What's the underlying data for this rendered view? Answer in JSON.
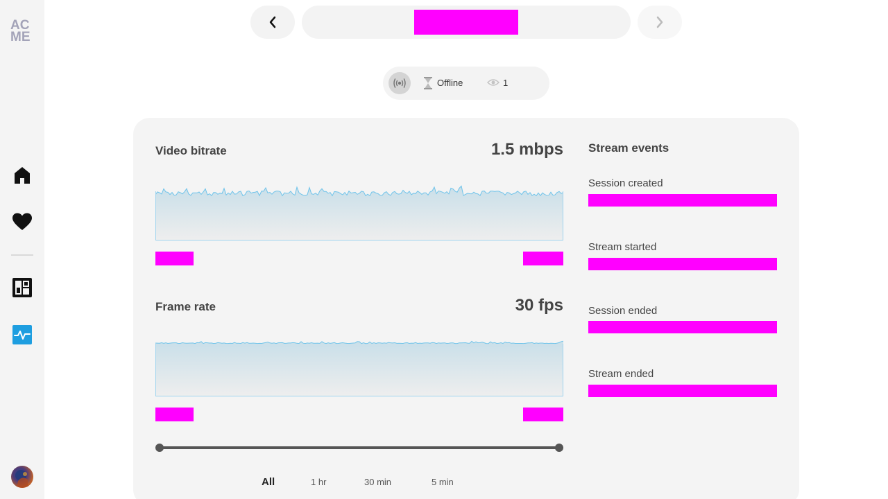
{
  "sidebar": {
    "logo_line1": "AC",
    "logo_line2": "ME",
    "items": [
      {
        "name": "home",
        "icon": "home-icon"
      },
      {
        "name": "favorites",
        "icon": "heart-icon"
      },
      {
        "name": "dashboard",
        "icon": "dashboard-icon"
      },
      {
        "name": "activity",
        "icon": "activity-icon",
        "active": true
      }
    ]
  },
  "status": {
    "state": "Offline",
    "viewers": "1"
  },
  "metrics": {
    "bitrate": {
      "title": "Video bitrate",
      "value": "1.5 mbps"
    },
    "framerate": {
      "title": "Frame rate",
      "value": "30 fps"
    }
  },
  "ranges": [
    "All",
    "1 hr",
    "30 min",
    "5 min"
  ],
  "events": {
    "title": "Stream events",
    "items": [
      "Session created",
      "Stream started",
      "Session ended",
      "Stream ended"
    ]
  },
  "colors": {
    "accent": "#1e9ee0",
    "chart_line": "#6ec3ea",
    "redaction": "#ff00ff"
  }
}
